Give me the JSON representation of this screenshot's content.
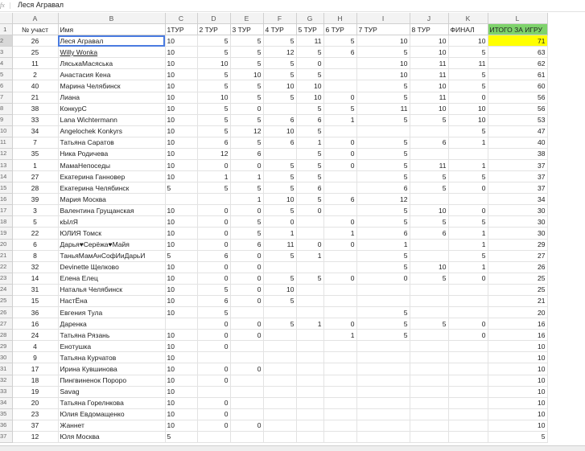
{
  "formula_bar": {
    "value": "Леся Агравал"
  },
  "column_letters": [
    "A",
    "B",
    "C",
    "D",
    "E",
    "F",
    "G",
    "H",
    "I",
    "J",
    "K",
    "L"
  ],
  "headers": [
    "№ участ",
    "Имя",
    "1ТУР",
    "2 ТУР",
    "3 ТУР",
    "4 ТУР",
    "5 ТУР",
    "6 ТУР",
    "7 ТУР",
    "8 ТУР",
    "ФИНАЛ",
    "ИТОГО ЗА ИГРУ"
  ],
  "colors": {
    "total_highlight": "#ffff00",
    "total_header": "#7ed36b",
    "selection": "#4a7be0"
  },
  "rows": [
    {
      "rn": "2",
      "cells": [
        "26",
        "Леся Агравал",
        "10",
        "5",
        "5",
        "5",
        "11",
        "5",
        "10",
        "10",
        "10",
        "71"
      ]
    },
    {
      "rn": "3",
      "cells": [
        "25",
        "Willy Wonka",
        "10",
        "5",
        "5",
        "12",
        "5",
        "6",
        "5",
        "10",
        "5",
        "63"
      ]
    },
    {
      "rn": "4",
      "cells": [
        "11",
        "ЛяськаМасяська",
        "10",
        "10",
        "5",
        "5",
        "0",
        "",
        "10",
        "11",
        "11",
        "62"
      ]
    },
    {
      "rn": "5",
      "cells": [
        "2",
        "Анастасия Кена",
        "10",
        "5",
        "10",
        "5",
        "5",
        "",
        "10",
        "11",
        "5",
        "61"
      ]
    },
    {
      "rn": "6",
      "cells": [
        "40",
        "Марина Челябинск",
        "10",
        "5",
        "5",
        "10",
        "10",
        "",
        "5",
        "10",
        "5",
        "60"
      ]
    },
    {
      "rn": "7",
      "cells": [
        "21",
        "Лиана",
        "10",
        "10",
        "5",
        "5",
        "10",
        "0",
        "5",
        "11",
        "0",
        "56"
      ]
    },
    {
      "rn": "8",
      "cells": [
        "38",
        "КонкурС",
        "10",
        "5",
        "0",
        "",
        "5",
        "5",
        "11",
        "10",
        "10",
        "56"
      ]
    },
    {
      "rn": "9",
      "cells": [
        "33",
        "Lana Wichtermann",
        "10",
        "5",
        "5",
        "6",
        "6",
        "1",
        "5",
        "5",
        "10",
        "53"
      ]
    },
    {
      "rn": "10",
      "cells": [
        "34",
        "Angelochek Konkyrs",
        "10",
        "5",
        "12",
        "10",
        "5",
        "",
        "",
        "",
        "5",
        "47"
      ]
    },
    {
      "rn": "11",
      "cells": [
        "7",
        "Татьяна Саратов",
        "10",
        "6",
        "5",
        "6",
        "1",
        "0",
        "5",
        "6",
        "1",
        "40"
      ]
    },
    {
      "rn": "12",
      "cells": [
        "35",
        "Ника Родичева",
        "10",
        "12",
        "6",
        "",
        "5",
        "0",
        "5",
        "",
        "",
        "38"
      ]
    },
    {
      "rn": "13",
      "cells": [
        "1",
        "МамаНепоседы",
        "10",
        "0",
        "0",
        "5",
        "5",
        "0",
        "5",
        "11",
        "1",
        "37"
      ]
    },
    {
      "rn": "14",
      "cells": [
        "27",
        "Екатерина Ганновер",
        "10",
        "1",
        "1",
        "5",
        "5",
        "",
        "5",
        "5",
        "5",
        "37"
      ]
    },
    {
      "rn": "15",
      "cells": [
        "28",
        "Екатерина Челябинск",
        "5",
        "5",
        "5",
        "5",
        "6",
        "",
        "6",
        "5",
        "0",
        "37"
      ]
    },
    {
      "rn": "16",
      "cells": [
        "39",
        "Мария Москва",
        "",
        "",
        "1",
        "10",
        "5",
        "6",
        "12",
        "",
        "",
        "34"
      ]
    },
    {
      "rn": "17",
      "cells": [
        "3",
        "Валентина Грущанская",
        "10",
        "0",
        "0",
        "5",
        "0",
        "",
        "5",
        "10",
        "0",
        "30"
      ]
    },
    {
      "rn": "18",
      "cells": [
        "5",
        "кЫлЯ",
        "10",
        "0",
        "5",
        "0",
        "",
        "0",
        "5",
        "5",
        "5",
        "30"
      ]
    },
    {
      "rn": "19",
      "cells": [
        "22",
        "ЮЛИЯ Томск",
        "10",
        "0",
        "5",
        "1",
        "",
        "1",
        "6",
        "6",
        "1",
        "30"
      ]
    },
    {
      "rn": "20",
      "cells": [
        "6",
        "Дарья♥Серёжа♥Майя",
        "10",
        "0",
        "6",
        "11",
        "0",
        "0",
        "1",
        "",
        "1",
        "29"
      ]
    },
    {
      "rn": "21",
      "cells": [
        "8",
        "ТаньяМамАнСофИиДарьИ",
        "5",
        "6",
        "0",
        "5",
        "1",
        "",
        "5",
        "",
        "5",
        "27"
      ]
    },
    {
      "rn": "22",
      "cells": [
        "32",
        "Devinette Щелково",
        "10",
        "0",
        "0",
        "",
        "",
        "",
        "5",
        "10",
        "1",
        "26"
      ]
    },
    {
      "rn": "23",
      "cells": [
        "14",
        "Елена Елец",
        "10",
        "0",
        "0",
        "5",
        "5",
        "0",
        "0",
        "5",
        "0",
        "25"
      ]
    },
    {
      "rn": "24",
      "cells": [
        "31",
        "Наталья Челябинск",
        "10",
        "5",
        "0",
        "10",
        "",
        "",
        "",
        "",
        "",
        "25"
      ]
    },
    {
      "rn": "25",
      "cells": [
        "15",
        "НастЁна",
        "10",
        "6",
        "0",
        "5",
        "",
        "",
        "",
        "",
        "",
        "21"
      ]
    },
    {
      "rn": "26",
      "cells": [
        "36",
        "Евгения Тула",
        "10",
        "5",
        "",
        "",
        "",
        "",
        "5",
        "",
        "",
        "20"
      ]
    },
    {
      "rn": "27",
      "cells": [
        "16",
        "Даренка",
        "",
        "0",
        "0",
        "5",
        "1",
        "0",
        "5",
        "5",
        "0",
        "16"
      ]
    },
    {
      "rn": "28",
      "cells": [
        "24",
        "Татьяна Рязань",
        "10",
        "0",
        "0",
        "",
        "",
        "1",
        "5",
        "",
        "0",
        "16"
      ]
    },
    {
      "rn": "29",
      "cells": [
        "4",
        "Енотушка",
        "10",
        "0",
        "",
        "",
        "",
        "",
        "",
        "",
        "",
        "10"
      ]
    },
    {
      "rn": "30",
      "cells": [
        "9",
        "Татьяна Курчатов",
        "10",
        "",
        "",
        "",
        "",
        "",
        "",
        "",
        "",
        "10"
      ]
    },
    {
      "rn": "31",
      "cells": [
        "17",
        "Ирина Кувшинова",
        "10",
        "0",
        "0",
        "",
        "",
        "",
        "",
        "",
        "",
        "10"
      ]
    },
    {
      "rn": "32",
      "cells": [
        "18",
        "Пингвиненок Пороро",
        "10",
        "0",
        "",
        "",
        "",
        "",
        "",
        "",
        "",
        "10"
      ]
    },
    {
      "rn": "33",
      "cells": [
        "19",
        "Savag",
        "10",
        "",
        "",
        "",
        "",
        "",
        "",
        "",
        "",
        "10"
      ]
    },
    {
      "rn": "34",
      "cells": [
        "20",
        "Татьяна Горелнкова",
        "10",
        "0",
        "",
        "",
        "",
        "",
        "",
        "",
        "",
        "10"
      ]
    },
    {
      "rn": "35",
      "cells": [
        "23",
        "Юлия Евдомащенко",
        "10",
        "0",
        "",
        "",
        "",
        "",
        "",
        "",
        "",
        "10"
      ]
    },
    {
      "rn": "36",
      "cells": [
        "37",
        "Жаннет",
        "10",
        "0",
        "0",
        "",
        "",
        "",
        "",
        "",
        "",
        "10"
      ]
    },
    {
      "rn": "37",
      "cells": [
        "12",
        "Юля Москва",
        "5",
        "",
        "",
        "",
        "",
        "",
        "",
        "",
        "",
        "5"
      ]
    }
  ]
}
